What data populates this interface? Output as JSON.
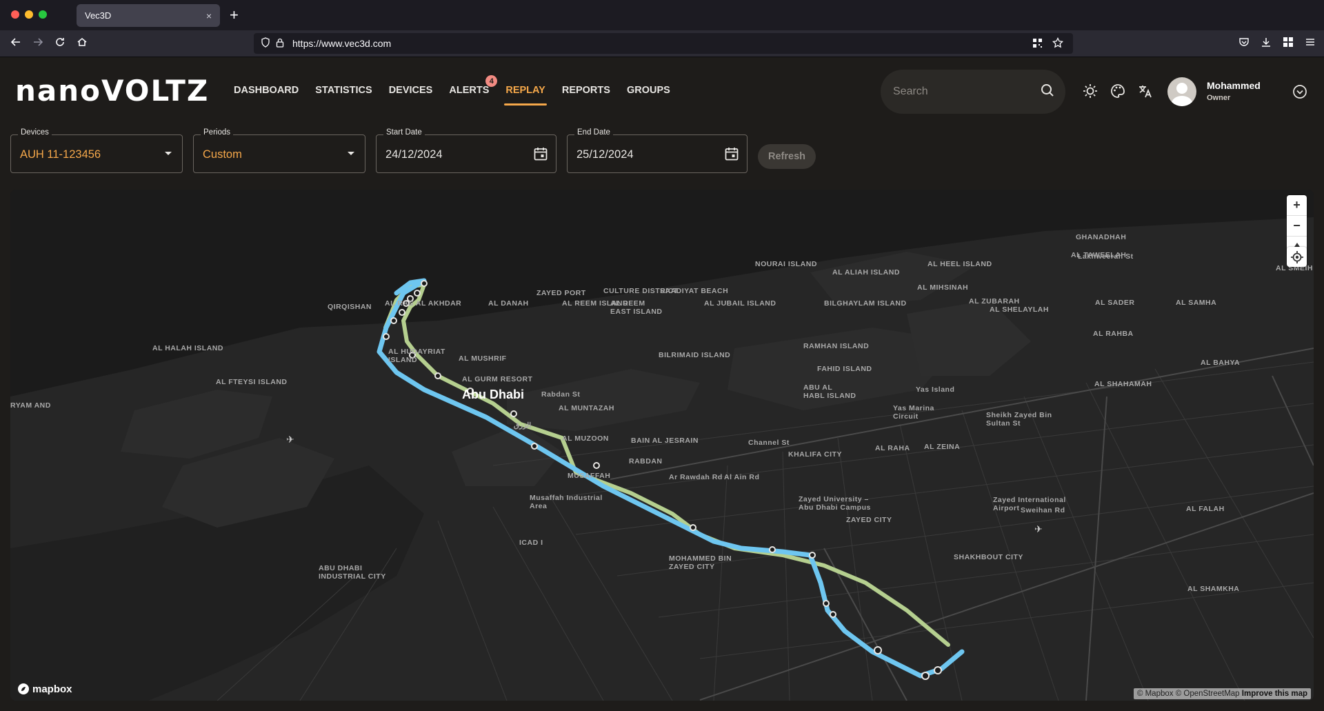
{
  "browser": {
    "tab_title": "Vec3D",
    "tab_close": "×",
    "new_tab": "+",
    "url": "https://www.vec3d.com",
    "traffic_colors": [
      "#ff5f57",
      "#febc2e",
      "#28c840"
    ]
  },
  "header": {
    "logo": "nanoVOLTZ",
    "menu": [
      {
        "label": "DASHBOARD"
      },
      {
        "label": "STATISTICS"
      },
      {
        "label": "DEVICES"
      },
      {
        "label": "ALERTS",
        "badge": "4"
      },
      {
        "label": "REPLAY",
        "active": true
      },
      {
        "label": "REPORTS"
      },
      {
        "label": "GROUPS"
      }
    ],
    "search_placeholder": "Search",
    "icons": [
      "sun-icon",
      "palette-icon",
      "translate-icon"
    ],
    "user": {
      "name": "Mohammed",
      "role": "Owner"
    },
    "accent_color": "#f6a84a"
  },
  "filters": {
    "devices": {
      "label": "Devices",
      "value": "AUH 11-123456"
    },
    "periods": {
      "label": "Periods",
      "value": "Custom"
    },
    "start_date": {
      "label": "Start Date",
      "value": "24/12/2024"
    },
    "end_date": {
      "label": "End Date",
      "value": "25/12/2024"
    },
    "refresh_label": "Refresh"
  },
  "map": {
    "controls": [
      "zoom-in",
      "zoom-out",
      "compass",
      "locate"
    ],
    "zoom_in": "+",
    "zoom_out": "−",
    "brand": "mapbox",
    "attribution": "© Mapbox © OpenStreetMap",
    "improve": "Improve this map",
    "route_colors": {
      "primary": "#6ec6f0",
      "secondary": "#b5cf8f"
    },
    "labels": {
      "city": "Abu Dhabi",
      "places": [
        "ZAYED PORT",
        "CULTURE DISTRICT",
        "SAADIYAT BEACH",
        "NOURAI ISLAND",
        "AL ALIAH ISLAND",
        "AL HEEL ISLAND",
        "AL MIHSINAH",
        "GHANADHAH",
        "AL TAWEELAH",
        "Lakhweerah St",
        "AL SMEIH",
        "QIRQISHAN",
        "AL RAS AL AKHDAR",
        "AL DANAH",
        "AL REEM ISLAND",
        "AL REEM EAST ISLAND",
        "AL JUBAIL ISLAND",
        "BILGHAYLAM ISLAND",
        "AL ZUBARAH",
        "AL SHELAYLAH",
        "AL SADER",
        "AL SAMHA",
        "AL HALAH ISLAND",
        "AL HUDAYRIAT ISLAND",
        "AL MUSHRIF",
        "AL GURM RESORT",
        "BILRIMAID ISLAND",
        "RAMHAN ISLAND",
        "FAHID ISLAND",
        "AL RAHBA",
        "AL BAHYA",
        "AL FTEYSI ISLAND",
        "ABU AL HABL ISLAND",
        "Yas Island",
        "Yas Marina Circuit",
        "AL SHAHAMAH",
        "AL MUNTAZAH",
        "AL MUZOON",
        "BAIN AL JESRAIN",
        "Channel St",
        "AL RAHA",
        "AL ZEINA",
        "KHALIFA CITY",
        "RABDAN",
        "MUSAFFAH",
        "Musaffah Industrial Area",
        "Zayed University – Abu Dhabi Campus",
        "Zayed International Airport",
        "AL FALAH",
        "ZAYED CITY",
        "ICAD I",
        "MOHAMMED BIN ZAYED CITY",
        "SHAKHBOUT CITY",
        "ABU DHABI INDUSTRIAL CITY",
        "AL SHAMKHA",
        "RYAM AND",
        "Sheikh Zayed Bin Sultan St",
        "Sweihan Rd",
        "Al Ain Rd",
        "Ar Rawdah Rd",
        "Rabdan St",
        "الزرق"
      ]
    }
  }
}
